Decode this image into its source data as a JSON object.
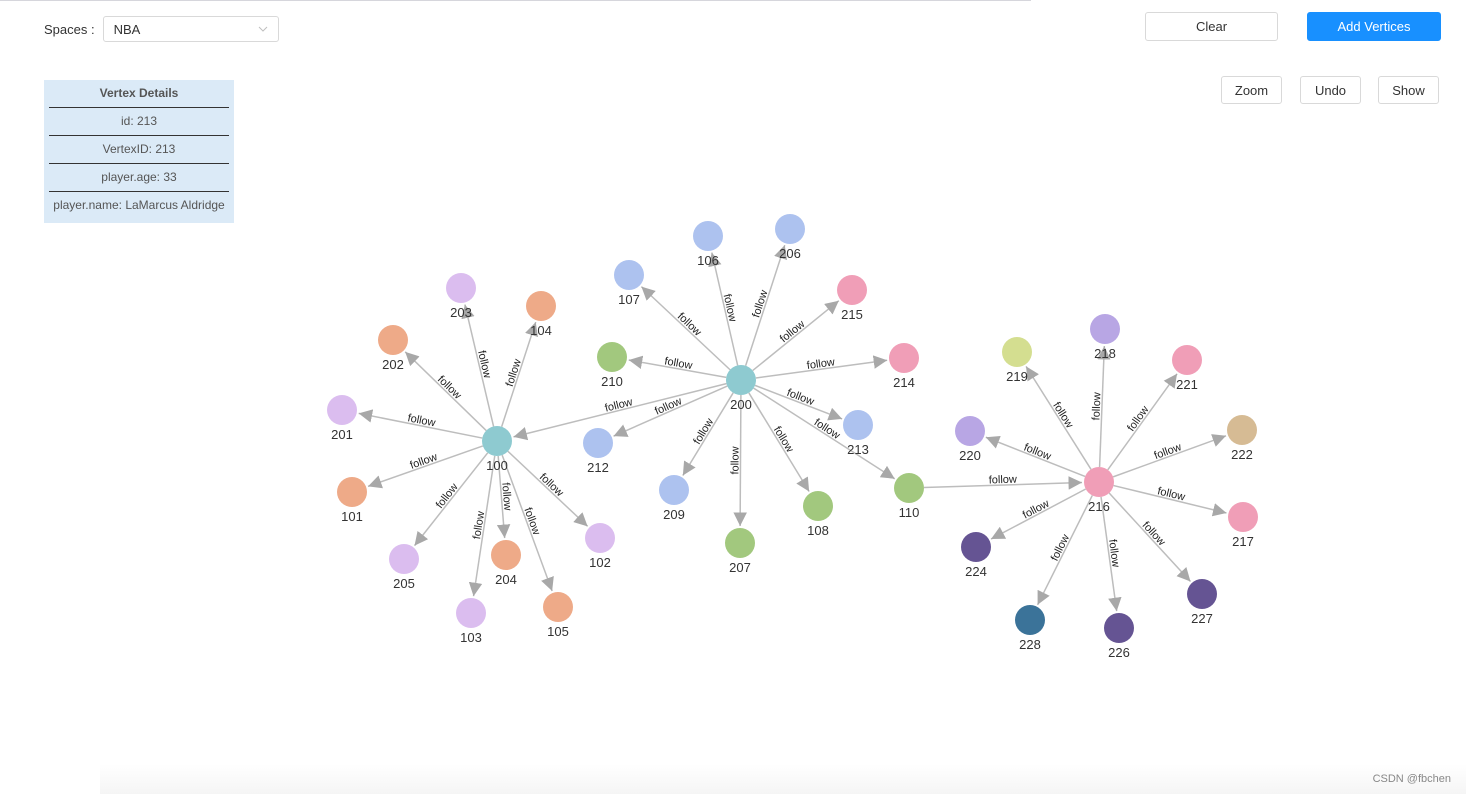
{
  "header": {
    "spaces_label": "Spaces :",
    "space_selected": "NBA",
    "clear_label": "Clear",
    "add_vertices_label": "Add Vertices"
  },
  "toolbar": {
    "zoom_label": "Zoom",
    "undo_label": "Undo",
    "show_label": "Show"
  },
  "vertex_details": {
    "title": "Vertex Details",
    "rows": [
      "id: 213",
      "VertexID: 213",
      "player.age: 33",
      "player.name: LaMarcus Aldridge"
    ]
  },
  "colors": {
    "primary": "#1890ff",
    "edge": "#bdbdbd",
    "arrow": "#a8a8a8"
  },
  "graph": {
    "edge_label": "follow",
    "nodes": [
      {
        "id": "100",
        "color": "#8ecad0"
      },
      {
        "id": "101",
        "color": "#eeaa88"
      },
      {
        "id": "102",
        "color": "#dbbdef"
      },
      {
        "id": "103",
        "color": "#dbbdef"
      },
      {
        "id": "104",
        "color": "#eeaa88"
      },
      {
        "id": "105",
        "color": "#eeaa88"
      },
      {
        "id": "201",
        "color": "#dbbdef"
      },
      {
        "id": "202",
        "color": "#eeaa88"
      },
      {
        "id": "203",
        "color": "#dbbdef"
      },
      {
        "id": "204",
        "color": "#eeaa88"
      },
      {
        "id": "205",
        "color": "#dbbdef"
      },
      {
        "id": "200",
        "color": "#8ecad0"
      },
      {
        "id": "106",
        "color": "#adc2ef"
      },
      {
        "id": "107",
        "color": "#adc2ef"
      },
      {
        "id": "108",
        "color": "#a2c87e"
      },
      {
        "id": "110",
        "color": "#a2c87e"
      },
      {
        "id": "206",
        "color": "#adc2ef"
      },
      {
        "id": "207",
        "color": "#a2c87e"
      },
      {
        "id": "209",
        "color": "#adc2ef"
      },
      {
        "id": "210",
        "color": "#a2c87e"
      },
      {
        "id": "212",
        "color": "#adc2ef"
      },
      {
        "id": "213",
        "color": "#adc2ef"
      },
      {
        "id": "214",
        "color": "#f09eb7"
      },
      {
        "id": "215",
        "color": "#f09eb7"
      },
      {
        "id": "216",
        "color": "#f09eb7"
      },
      {
        "id": "217",
        "color": "#f09eb7"
      },
      {
        "id": "218",
        "color": "#b8a6e4"
      },
      {
        "id": "219",
        "color": "#d4de90"
      },
      {
        "id": "220",
        "color": "#b8a6e4"
      },
      {
        "id": "221",
        "color": "#f09eb7"
      },
      {
        "id": "222",
        "color": "#d6bb94"
      },
      {
        "id": "224",
        "color": "#655493"
      },
      {
        "id": "226",
        "color": "#655493"
      },
      {
        "id": "227",
        "color": "#655493"
      },
      {
        "id": "228",
        "color": "#3b7399"
      }
    ],
    "edges": [
      {
        "from": "100",
        "to": "201"
      },
      {
        "from": "100",
        "to": "202"
      },
      {
        "from": "100",
        "to": "203"
      },
      {
        "from": "100",
        "to": "104"
      },
      {
        "from": "100",
        "to": "101"
      },
      {
        "from": "100",
        "to": "205"
      },
      {
        "from": "100",
        "to": "103"
      },
      {
        "from": "100",
        "to": "204"
      },
      {
        "from": "100",
        "to": "105"
      },
      {
        "from": "100",
        "to": "102"
      },
      {
        "from": "200",
        "to": "100"
      },
      {
        "from": "200",
        "to": "107"
      },
      {
        "from": "200",
        "to": "106"
      },
      {
        "from": "200",
        "to": "206"
      },
      {
        "from": "200",
        "to": "215"
      },
      {
        "from": "200",
        "to": "210"
      },
      {
        "from": "200",
        "to": "214"
      },
      {
        "from": "200",
        "to": "212"
      },
      {
        "from": "200",
        "to": "213"
      },
      {
        "from": "200",
        "to": "110"
      },
      {
        "from": "200",
        "to": "209"
      },
      {
        "from": "200",
        "to": "207"
      },
      {
        "from": "200",
        "to": "108"
      },
      {
        "from": "110",
        "to": "216"
      },
      {
        "from": "216",
        "to": "219"
      },
      {
        "from": "216",
        "to": "218"
      },
      {
        "from": "216",
        "to": "221"
      },
      {
        "from": "216",
        "to": "220"
      },
      {
        "from": "216",
        "to": "222"
      },
      {
        "from": "216",
        "to": "217"
      },
      {
        "from": "216",
        "to": "224"
      },
      {
        "from": "216",
        "to": "228"
      },
      {
        "from": "216",
        "to": "226"
      },
      {
        "from": "216",
        "to": "227"
      }
    ]
  },
  "footer": {
    "watermark": "CSDN @fbchen"
  }
}
